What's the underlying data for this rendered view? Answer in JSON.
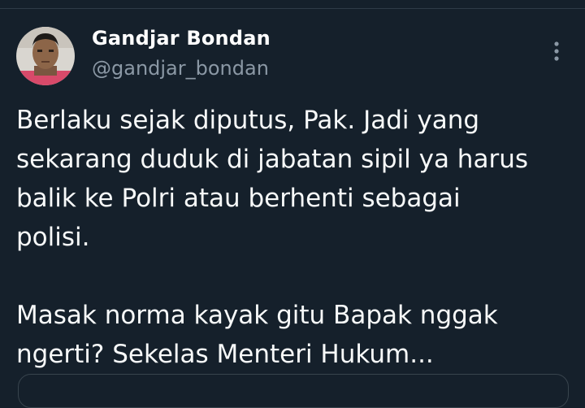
{
  "tweet": {
    "author": {
      "display_name": "Gandjar Bondan",
      "handle": "@gandjar_bondan",
      "avatar_icon": "profile-photo"
    },
    "more_icon": "more-vertical-icon",
    "text": {
      "paragraph_1": [
        "Berlaku sejak diputus, Pak. Jadi yang",
        "sekarang duduk di jabatan sipil ya harus",
        "balik ke Polri atau berhenti sebagai",
        "polisi."
      ],
      "paragraph_2": [
        "Masak norma kayak gitu Bapak nggak",
        "ngerti? Sekelas Menteri Hukum..."
      ]
    }
  },
  "colors": {
    "background": "#15202b",
    "text_primary": "#f7f9f9",
    "text_secondary": "#8b98a5",
    "border": "#38444d"
  }
}
